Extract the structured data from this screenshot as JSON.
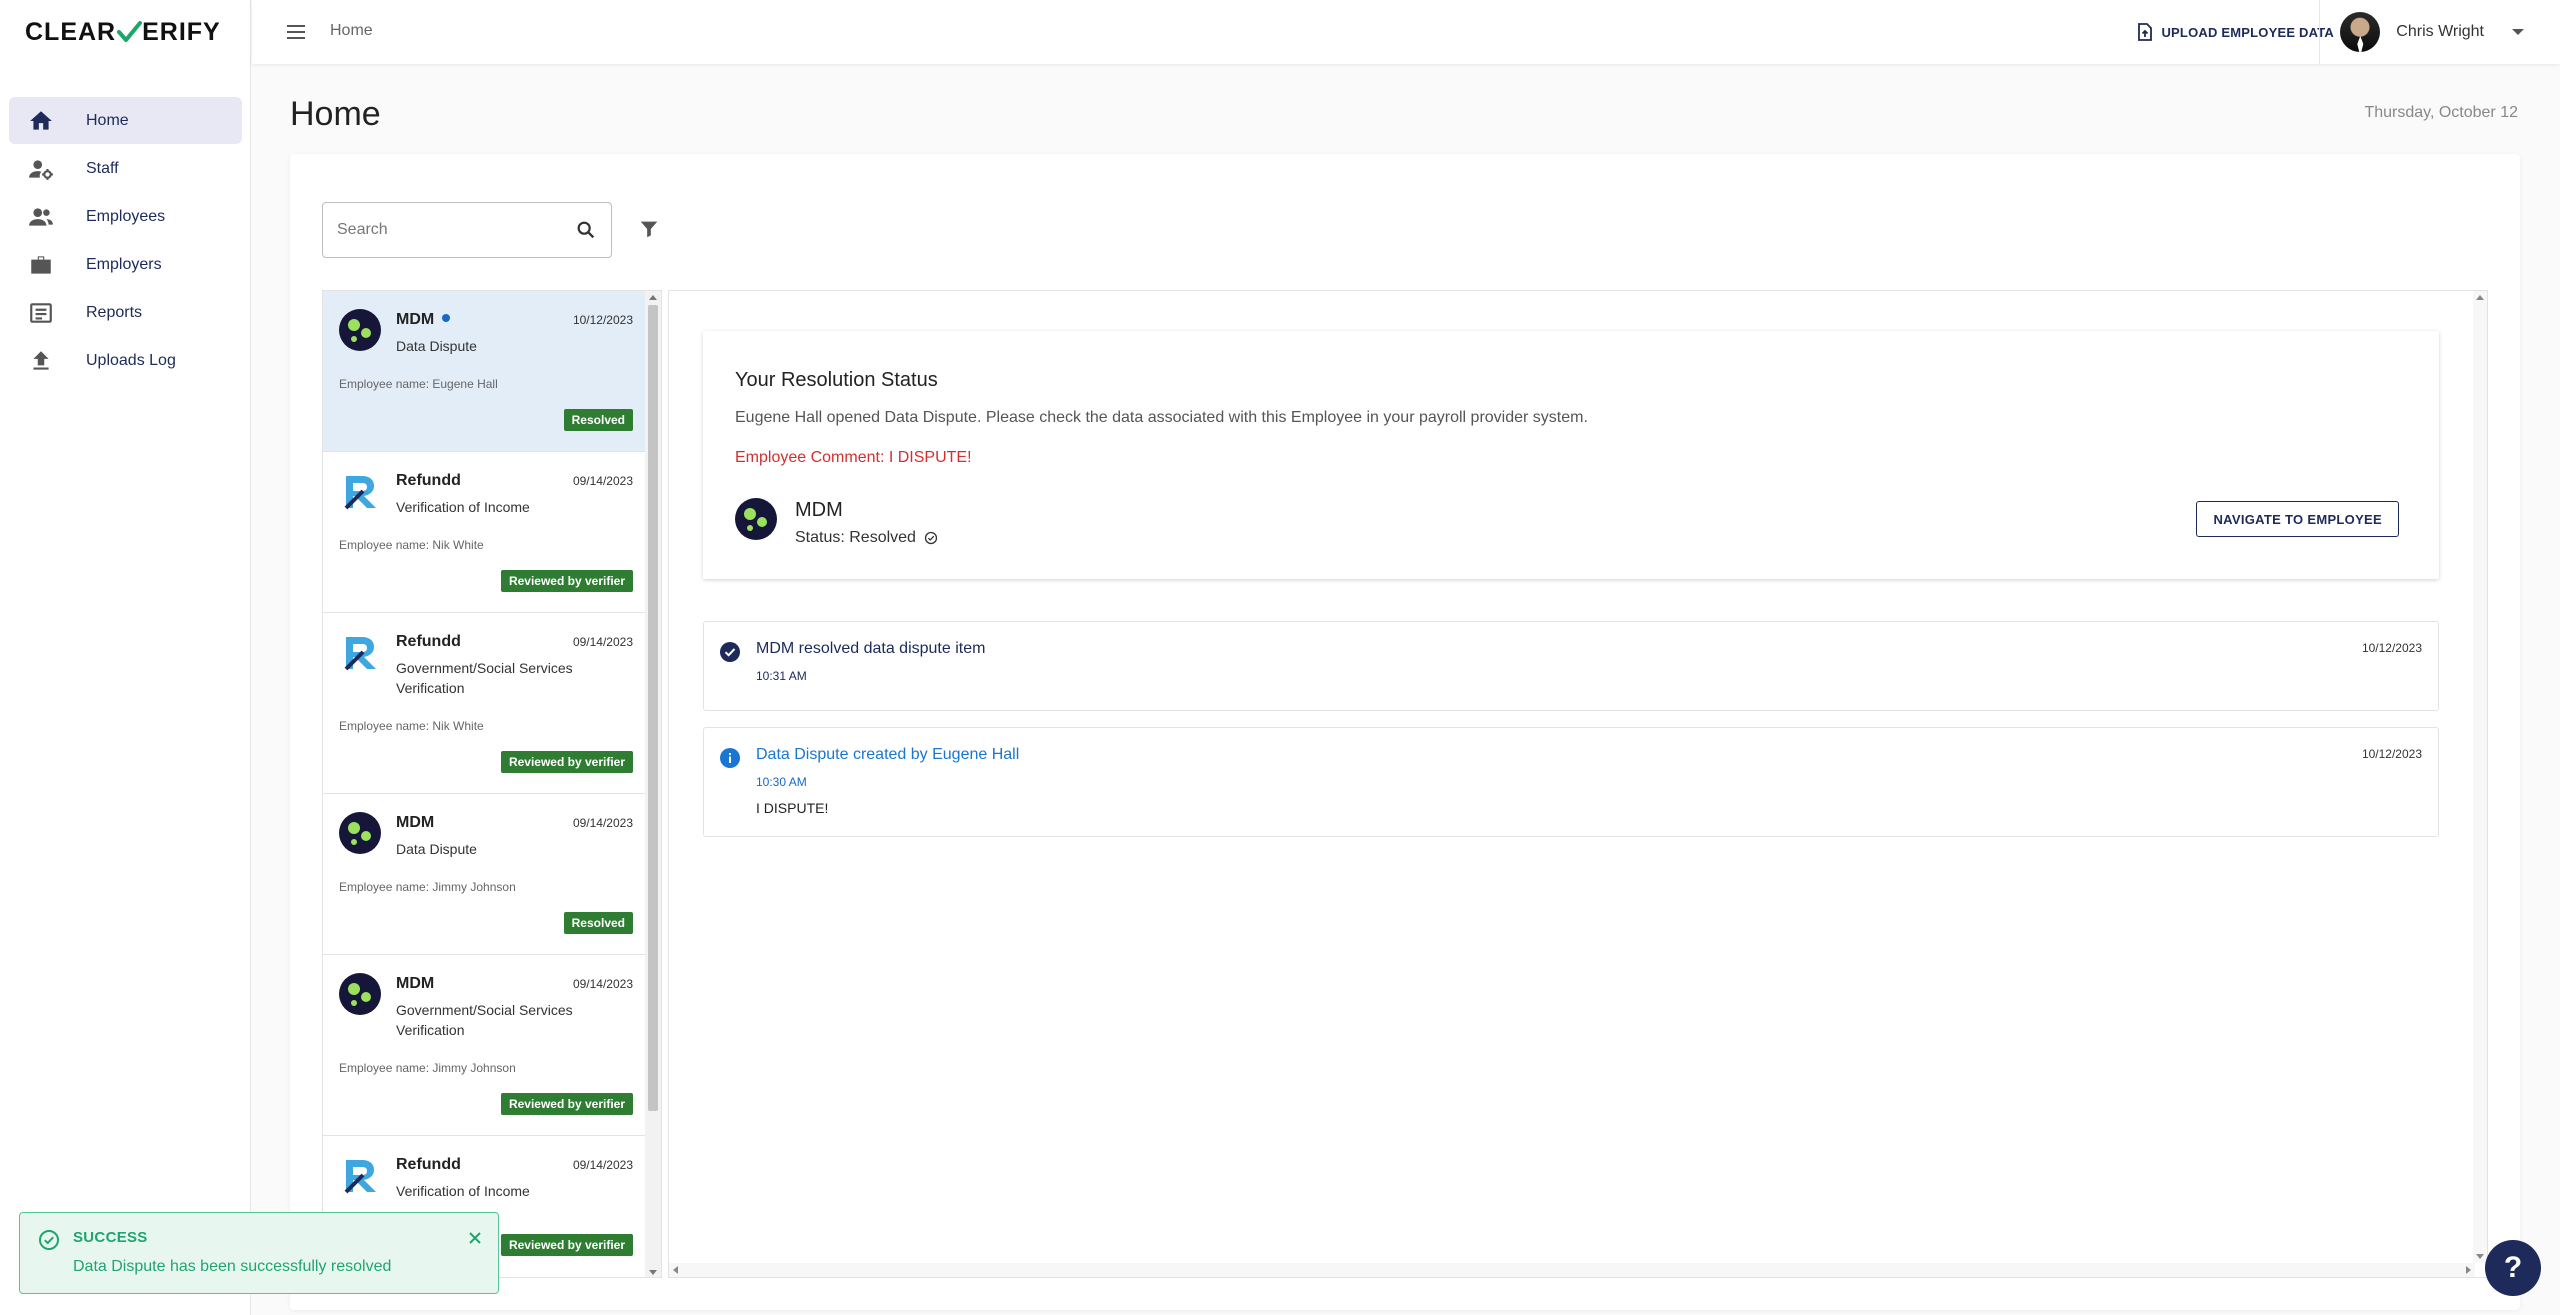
{
  "app": {
    "logo_text_left": "CLEAR",
    "logo_text_right": "ERIFY"
  },
  "sidebar": {
    "items": [
      {
        "label": "Home",
        "icon": "home-icon",
        "active": true
      },
      {
        "label": "Staff",
        "icon": "staff-icon"
      },
      {
        "label": "Employees",
        "icon": "employees-icon"
      },
      {
        "label": "Employers",
        "icon": "briefcase-icon"
      },
      {
        "label": "Reports",
        "icon": "reports-icon"
      },
      {
        "label": "Uploads Log",
        "icon": "upload-icon"
      }
    ]
  },
  "topbar": {
    "breadcrumb": "Home",
    "upload_label": "UPLOAD EMPLOYEE DATA",
    "user_name": "Chris Wright"
  },
  "page": {
    "title": "Home",
    "date": "Thursday, October 12"
  },
  "search": {
    "placeholder": "Search"
  },
  "list": [
    {
      "name": "MDM",
      "unread": true,
      "date": "10/12/2023",
      "type": "Data Dispute",
      "employee": "Employee name: Eugene Hall",
      "badge": "Resolved",
      "logo": "mdm",
      "selected": true
    },
    {
      "name": "Refundd",
      "date": "09/14/2023",
      "type": "Verification of Income",
      "employee": "Employee name: Nik White",
      "badge": "Reviewed by verifier",
      "logo": "refundd"
    },
    {
      "name": "Refundd",
      "date": "09/14/2023",
      "type": "Government/Social Services Verification",
      "employee": "Employee name: Nik White",
      "badge": "Reviewed by verifier",
      "logo": "refundd"
    },
    {
      "name": "MDM",
      "date": "09/14/2023",
      "type": "Data Dispute",
      "employee": "Employee name: Jimmy Johnson",
      "badge": "Resolved",
      "logo": "mdm"
    },
    {
      "name": "MDM",
      "date": "09/14/2023",
      "type": "Government/Social Services Verification",
      "employee": "Employee name: Jimmy Johnson",
      "badge": "Reviewed by verifier",
      "logo": "mdm"
    },
    {
      "name": "Refundd",
      "date": "09/14/2023",
      "type": "Verification of Income",
      "employee": "",
      "badge": "Reviewed by verifier",
      "logo": "refundd"
    }
  ],
  "detail": {
    "title": "Your Resolution Status",
    "description": "Eugene Hall opened Data Dispute. Please check the data associated with this Employee in your payroll provider system.",
    "comment": "Employee Comment: I DISPUTE!",
    "org_name": "MDM",
    "status": "Status: Resolved",
    "navigate_label": "NAVIGATE TO EMPLOYEE",
    "timeline": [
      {
        "title": "MDM resolved data dispute item",
        "time": "10:31 AM",
        "date": "10/12/2023",
        "icon": "check-circle-icon",
        "color": "#1d2a5a",
        "body": ""
      },
      {
        "title": "Data Dispute created by Eugene Hall",
        "time": "10:30 AM",
        "date": "10/12/2023",
        "icon": "info-circle-icon",
        "color": "#1976d2",
        "body": "I DISPUTE!"
      }
    ]
  },
  "toast": {
    "title": "SUCCESS",
    "message": "Data Dispute has been successfully resolved"
  },
  "colors": {
    "accent": "#1d2a5a",
    "success": "#2e7d32",
    "toast": "#20a472",
    "danger": "#d32f2f",
    "link": "#1769c9"
  }
}
